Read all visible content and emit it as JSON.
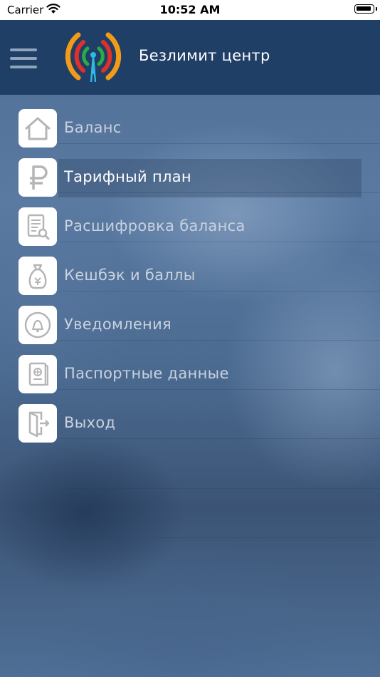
{
  "status_bar": {
    "carrier": "Carrier",
    "time": "10:52 AM"
  },
  "header": {
    "title": "Безлимит центр",
    "background": "#1f3f66"
  },
  "menu": {
    "items": [
      {
        "label": "Баланс",
        "icon": "home-icon",
        "active": false
      },
      {
        "label": "Тарифный план",
        "icon": "ruble-icon",
        "active": true
      },
      {
        "label": "Расшифровка баланса",
        "icon": "document-search-icon",
        "active": false
      },
      {
        "label": "Кешбэк и баллы",
        "icon": "money-bag-icon",
        "active": false
      },
      {
        "label": "Уведомления",
        "icon": "bell-icon",
        "active": false
      },
      {
        "label": "Паспортные данные",
        "icon": "passport-icon",
        "active": false
      },
      {
        "label": "Выход",
        "icon": "exit-door-icon",
        "active": false
      }
    ]
  },
  "colors": {
    "accent_orange": "#f29a1a",
    "accent_red": "#e0302a",
    "accent_green": "#2ea84a",
    "accent_cyan": "#2fb9e6",
    "icon_gray": "#b5b5b5"
  }
}
